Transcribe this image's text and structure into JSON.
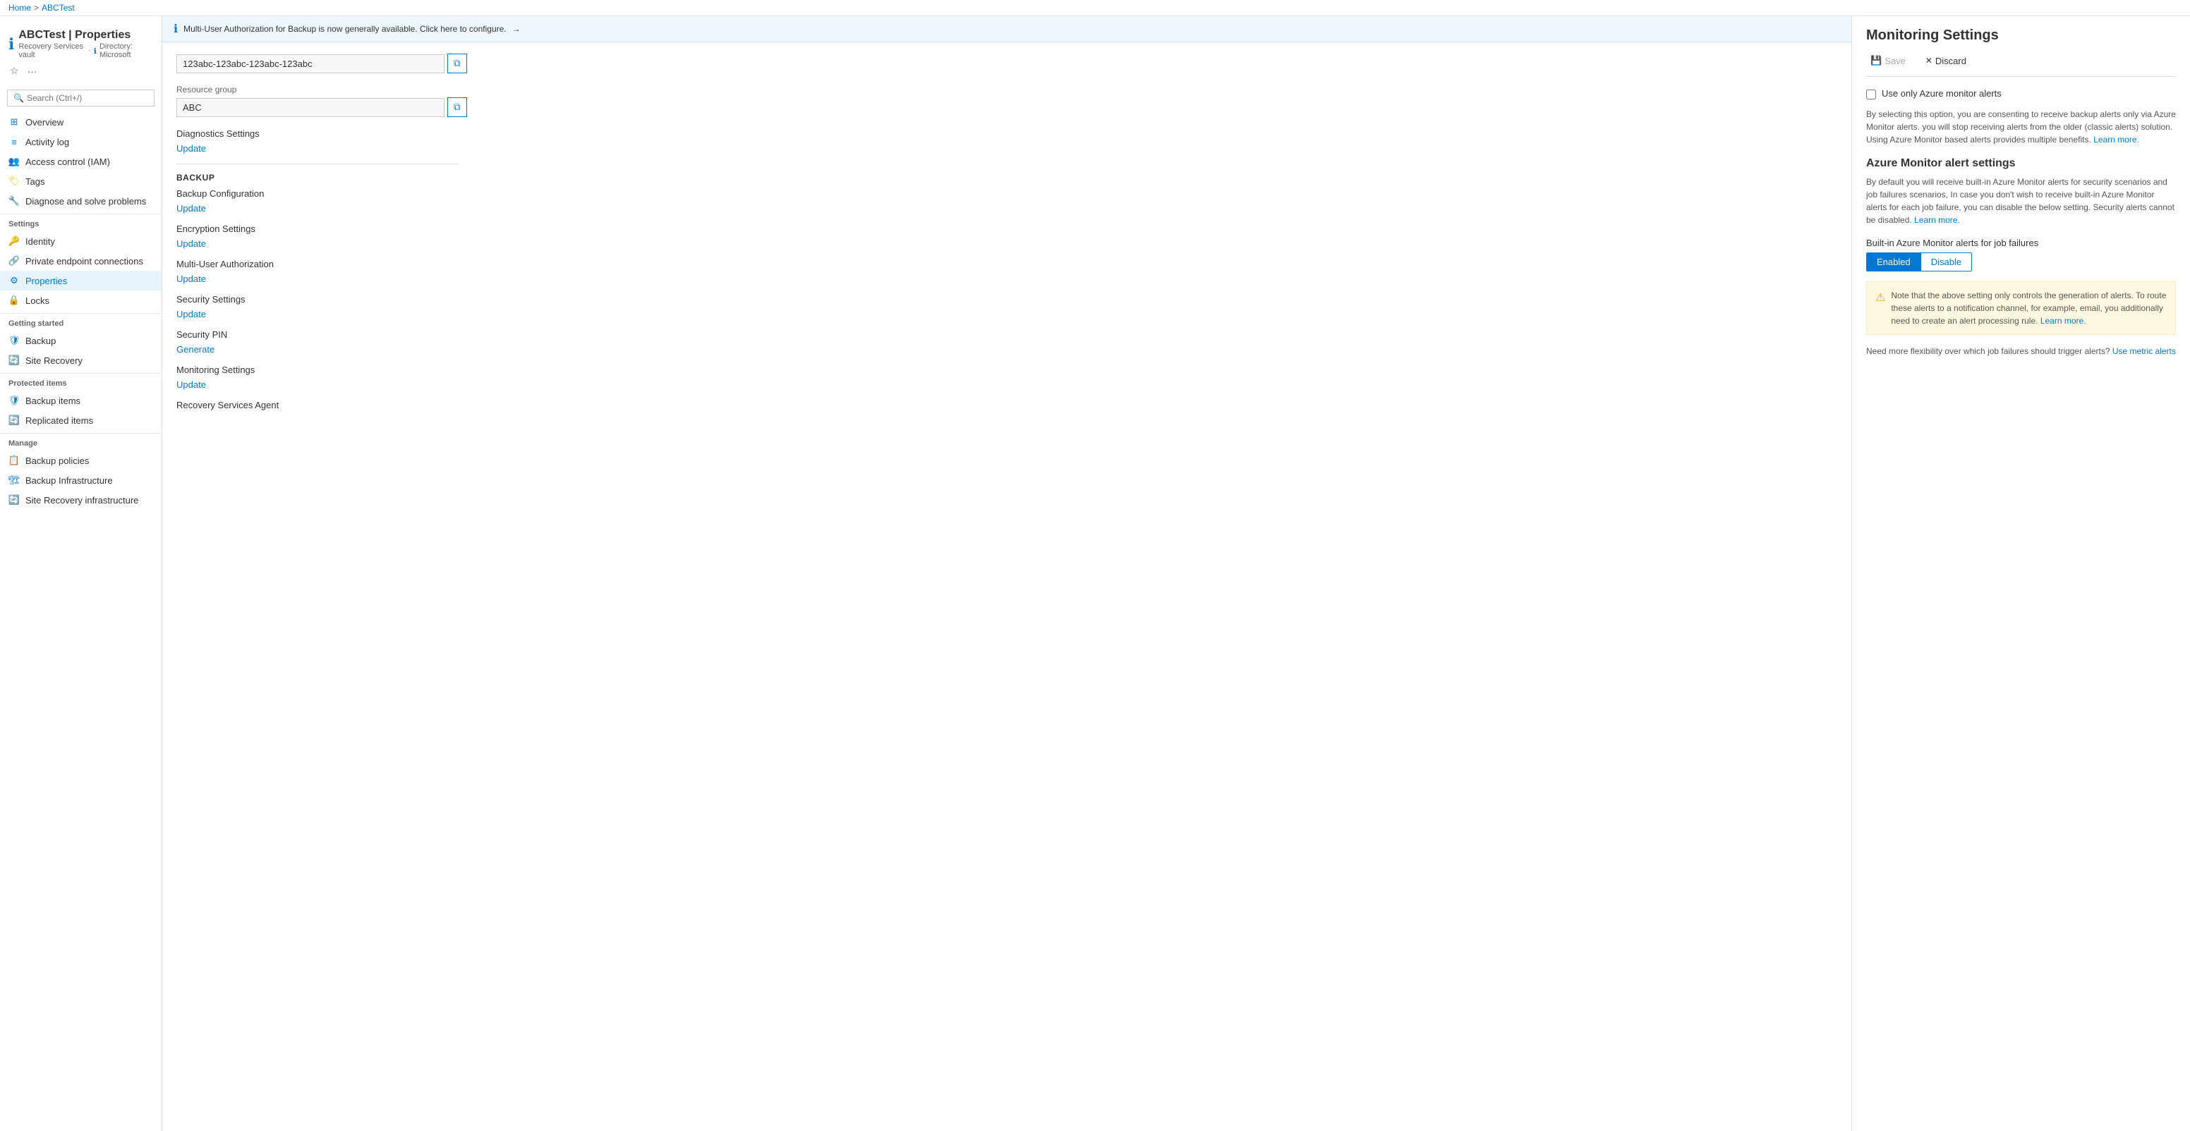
{
  "breadcrumb": {
    "items": [
      "Home",
      "ABCTest"
    ]
  },
  "sidebar": {
    "title": "ABCTest | Properties",
    "subtitle": "Recovery Services vault",
    "directory": "Directory: Microsoft",
    "search_placeholder": "Search (Ctrl+/)",
    "collapse_icon": "«",
    "nav_items": [
      {
        "id": "overview",
        "label": "Overview",
        "icon": "grid"
      },
      {
        "id": "activity-log",
        "label": "Activity log",
        "icon": "list"
      },
      {
        "id": "access-control",
        "label": "Access control (IAM)",
        "icon": "people"
      },
      {
        "id": "tags",
        "label": "Tags",
        "icon": "tag"
      },
      {
        "id": "diagnose",
        "label": "Diagnose and solve problems",
        "icon": "wrench"
      }
    ],
    "sections": [
      {
        "label": "Settings",
        "items": [
          {
            "id": "identity",
            "label": "Identity",
            "icon": "id"
          },
          {
            "id": "private-endpoints",
            "label": "Private endpoint connections",
            "icon": "lock"
          },
          {
            "id": "properties",
            "label": "Properties",
            "icon": "bars",
            "active": true
          },
          {
            "id": "locks",
            "label": "Locks",
            "icon": "lock2"
          }
        ]
      },
      {
        "label": "Getting started",
        "items": [
          {
            "id": "backup",
            "label": "Backup",
            "icon": "backup"
          },
          {
            "id": "site-recovery",
            "label": "Site Recovery",
            "icon": "site-recovery"
          }
        ]
      },
      {
        "label": "Protected items",
        "items": [
          {
            "id": "backup-items",
            "label": "Backup items",
            "icon": "backup-items"
          },
          {
            "id": "replicated-items",
            "label": "Replicated items",
            "icon": "replicated"
          }
        ]
      },
      {
        "label": "Manage",
        "items": [
          {
            "id": "backup-policies",
            "label": "Backup policies",
            "icon": "policy"
          },
          {
            "id": "backup-infrastructure",
            "label": "Backup Infrastructure",
            "icon": "infrastructure"
          },
          {
            "id": "site-recovery-infra",
            "label": "Site Recovery infrastructure",
            "icon": "site-recovery-infra"
          }
        ]
      }
    ]
  },
  "notification": {
    "text": "Multi-User Authorization for Backup is now generally available. Click here to configure.",
    "arrow": "→"
  },
  "properties": {
    "subscription_id_label": "",
    "subscription_id_value": "123abc-123abc-123abc-123abc",
    "resource_group_label": "Resource group",
    "resource_group_value": "ABC",
    "diagnostics_label": "Diagnostics Settings",
    "diagnostics_link": "Update",
    "backup_section": "BACKUP",
    "backup_config_label": "Backup Configuration",
    "backup_config_link": "Update",
    "encryption_label": "Encryption Settings",
    "encryption_link": "Update",
    "multi_user_label": "Multi-User Authorization",
    "multi_user_link": "Update",
    "security_settings_label": "Security Settings",
    "security_settings_link": "Update",
    "security_pin_label": "Security PIN",
    "security_pin_link": "Generate",
    "monitoring_label": "Monitoring Settings",
    "monitoring_link": "Update",
    "agent_label": "Recovery Services Agent"
  },
  "right_panel": {
    "title": "Monitoring Settings",
    "save_label": "Save",
    "discard_label": "Discard",
    "checkbox_label": "Use only Azure monitor alerts",
    "description1": "By selecting this option, you are consenting to receive backup alerts only via Azure Monitor alerts. you will stop receiving alerts from the older (classic alerts) solution. Using Azure Monitor based alerts provides multiple benefits.",
    "learn_more_1": "Learn more.",
    "azure_monitor_title": "Azure Monitor alert settings",
    "description2": "By default you will receive built-in Azure Monitor alerts for security scenarios and job failures scenarios, In case you don't wish to receive built-in Azure Monitor alerts for each job failure, you can disable the below setting. Security alerts cannot be disabled.",
    "learn_more_2": "Learn more.",
    "builtin_label": "Built-in Azure Monitor alerts for job failures",
    "toggle_enabled": "Enabled",
    "toggle_disable": "Disable",
    "warning_text": "Note that the above setting only controls the generation of alerts. To route these alerts to a notification channel, for example, email, you additionally need to create an alert processing rule.",
    "learn_more_3": "Learn more.",
    "flexibility_text": "Need more flexibility over which job failures should trigger alerts?",
    "metric_link": "Use metric alerts"
  },
  "icons": {
    "info": "ℹ",
    "search": "🔍",
    "star": "☆",
    "more": "···",
    "copy": "⧉",
    "save": "💾",
    "discard": "✕",
    "warning": "⚠"
  }
}
